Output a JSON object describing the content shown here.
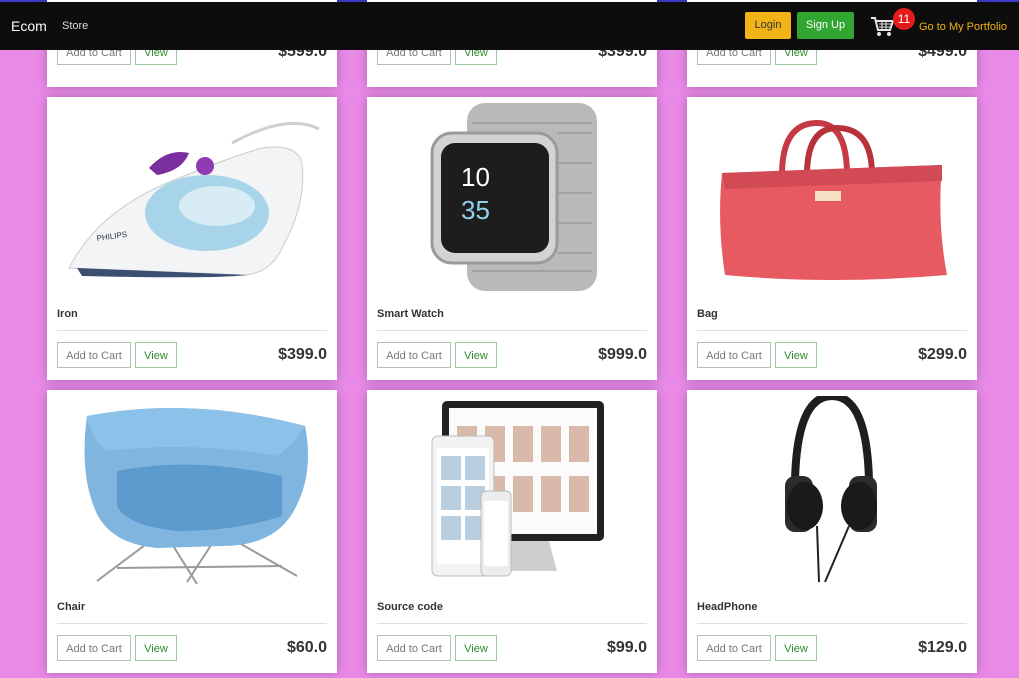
{
  "nav": {
    "brand": "Ecom",
    "store": "Store",
    "login": "Login",
    "signup": "Sign Up",
    "cart_count": "11",
    "portfolio": "Go to My Portfolio"
  },
  "buttons": {
    "add_to_cart": "Add to Cart",
    "view": "View"
  },
  "products_top": [
    {
      "price": "$599.0"
    },
    {
      "price": "$399.0"
    },
    {
      "price": "$499.0"
    }
  ],
  "products": [
    {
      "name": "Iron",
      "price": "$399.0"
    },
    {
      "name": "Smart Watch",
      "price": "$999.0"
    },
    {
      "name": "Bag",
      "price": "$299.0"
    },
    {
      "name": "Chair",
      "price": "$60.0"
    },
    {
      "name": "Source code",
      "price": "$99.0"
    },
    {
      "name": "HeadPhone",
      "price": "$129.0"
    }
  ],
  "colors": {
    "background": "#e98ae9",
    "login": "#f2b316",
    "signup": "#32a632",
    "badge": "#e31b1b"
  }
}
